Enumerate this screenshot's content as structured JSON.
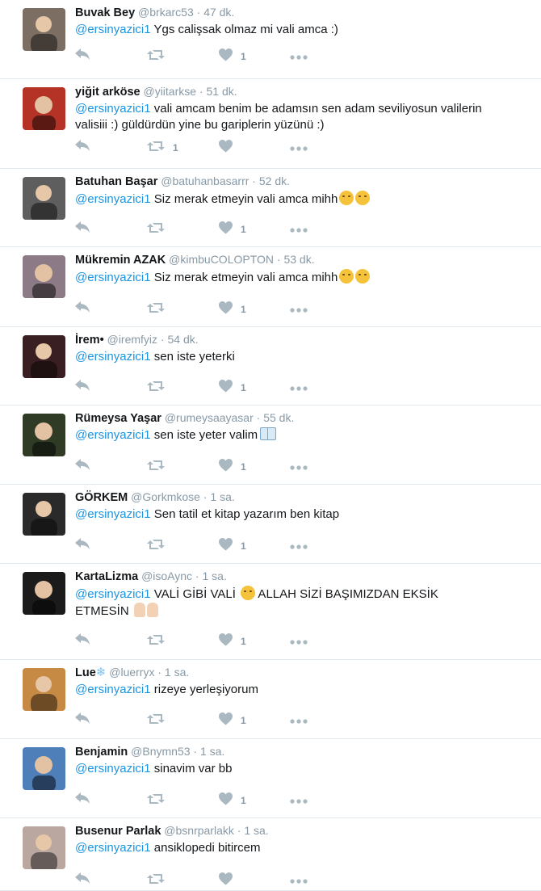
{
  "tweets": [
    {
      "name": "Buvak Bey",
      "handle": "@brkarc53",
      "time": "47 dk.",
      "mention": "@ersinyazici1",
      "text": " Ygs calişsak olmaz mi vali amca :)",
      "retweets": "",
      "likes": "1",
      "emoji": "",
      "avatar_color": "#7d6e63"
    },
    {
      "name": "yiğit arköse",
      "handle": "@yiitarkse",
      "time": "51 dk.",
      "mention": "@ersinyazici1",
      "text": " vali amcam benim be adamsın sen adam seviliyosun valilerin valisiii :) güldürdün yine bu gariplerin yüzünü :)",
      "retweets": "1",
      "likes": "",
      "emoji": "",
      "avatar_color": "#b53227"
    },
    {
      "name": "Batuhan Başar",
      "handle": "@batuhanbasarrr",
      "time": "52 dk.",
      "mention": "@ersinyazici1",
      "text": " Siz merak etmeyin vali amca mihh",
      "retweets": "",
      "likes": "1",
      "emoji": "face2",
      "avatar_color": "#5e5e5e"
    },
    {
      "name": "Mükremin AZAK",
      "handle": "@kimbuCOLOPTON",
      "time": "53 dk.",
      "mention": "@ersinyazici1",
      "text": " Siz merak etmeyin vali amca mihh",
      "retweets": "",
      "likes": "1",
      "emoji": "face2",
      "avatar_color": "#8c7a86"
    },
    {
      "name": "İrem•",
      "handle": "@iremfyiz",
      "time": "54 dk.",
      "mention": "@ersinyazici1",
      "text": " sen iste yeterki",
      "retweets": "",
      "likes": "1",
      "emoji": "",
      "avatar_color": "#3a1f22"
    },
    {
      "name": "Rümeysa Yaşar",
      "handle": "@rumeysaayasar",
      "time": "55 dk.",
      "mention": "@ersinyazici1",
      "text": " sen iste yeter valim",
      "retweets": "",
      "likes": "1",
      "emoji": "book",
      "avatar_color": "#2f3b24"
    },
    {
      "name": "GÖRKEM",
      "handle": "@Gorkmkose",
      "time": "1 sa.",
      "mention": "@ersinyazici1",
      "text": " Sen tatil et kitap yazarım ben kitap",
      "retweets": "",
      "likes": "1",
      "emoji": "",
      "avatar_color": "#2a2a2a"
    },
    {
      "name": "KartaLizma",
      "handle": "@isoAync",
      "time": "1 sa.",
      "mention": "@ersinyazici1",
      "text": " VALİ GİBİ VALİ",
      "text2": " ALLAH SİZİ BAŞIMIZDAN EKSİK ETMESİN",
      "retweets": "",
      "likes": "1",
      "emoji": "face-hands",
      "avatar_color": "#1b1b1b"
    },
    {
      "name": "Lue",
      "handle": "@luerryx",
      "time": "1 sa.",
      "mention": "@ersinyazici1",
      "text": " rizeye yerleşiyorum",
      "retweets": "",
      "likes": "1",
      "emoji": "",
      "avatar_color": "#c68a44"
    },
    {
      "name": "Benjamin",
      "handle": "@Bnymn53",
      "time": "1 sa.",
      "mention": "@ersinyazici1",
      "text": " sinavim var bb",
      "retweets": "",
      "likes": "1",
      "emoji": "",
      "avatar_color": "#4f7fb8"
    },
    {
      "name": "Busenur Parlak",
      "handle": "@bsnrparlakk",
      "time": "1 sa.",
      "mention": "@ersinyazici1",
      "text": " ansiklopedi bitircem",
      "retweets": "",
      "likes": "",
      "emoji": "",
      "avatar_color": "#b9a7a0"
    }
  ],
  "icons": {
    "reply": "reply-icon",
    "retweet": "retweet-icon",
    "like": "heart-icon",
    "more": "more-icon"
  },
  "colors": {
    "mention": "#1b95e0",
    "meta": "#8899a6",
    "icon": "#aab8c2",
    "divider": "#e1e8ed"
  }
}
